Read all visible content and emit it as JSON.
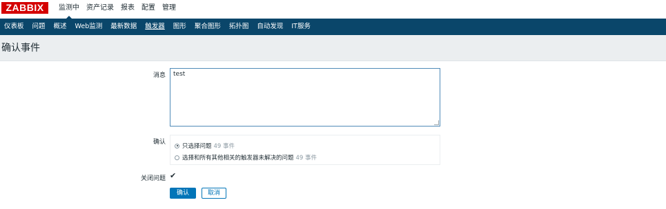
{
  "logo": {
    "text": "ZABBIX",
    "color": "#d40000"
  },
  "main_menu": {
    "items": [
      {
        "label": "监测中",
        "active": true
      },
      {
        "label": "资产记录",
        "active": false
      },
      {
        "label": "报表",
        "active": false
      },
      {
        "label": "配置",
        "active": false
      },
      {
        "label": "管理",
        "active": false
      }
    ]
  },
  "sub_menu": {
    "items": [
      {
        "label": "仪表板",
        "active": false
      },
      {
        "label": "问题",
        "active": false
      },
      {
        "label": "概述",
        "active": false
      },
      {
        "label": "Web监测",
        "active": false
      },
      {
        "label": "最新数据",
        "active": false
      },
      {
        "label": "触发器",
        "active": true
      },
      {
        "label": "图形",
        "active": false
      },
      {
        "label": "聚合图形",
        "active": false
      },
      {
        "label": "拓扑图",
        "active": false
      },
      {
        "label": "自动发现",
        "active": false
      },
      {
        "label": "IT服务",
        "active": false
      }
    ]
  },
  "page": {
    "title": "确认事件"
  },
  "form": {
    "message_label": "消息",
    "message_value": "test",
    "ack_label": "确认",
    "ack_options": [
      {
        "label": "只选择问题",
        "count": "49 事件",
        "selected": true
      },
      {
        "label": "选择和所有其他相关的触发器未解决的问题",
        "count": "49 事件",
        "selected": false
      }
    ],
    "close_label": "关闭问题",
    "close_checked": true,
    "close_check_glyph": "✔",
    "submit_label": "确认",
    "cancel_label": "取消"
  },
  "colors": {
    "nav_bar": "#0a466a",
    "primary_button": "#0275b8",
    "header_bg": "#ebeef0"
  }
}
